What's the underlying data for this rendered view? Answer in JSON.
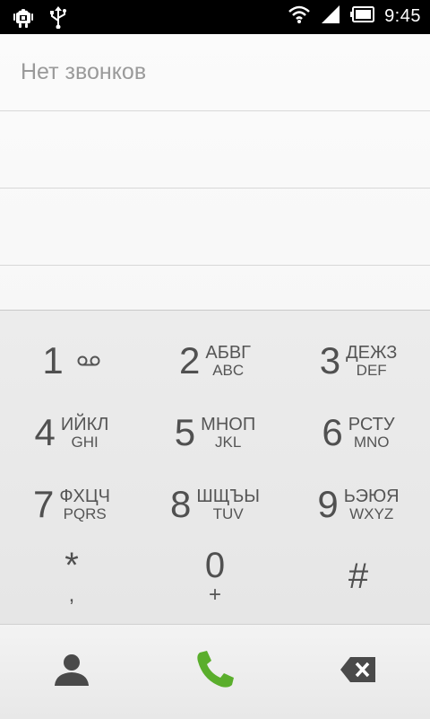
{
  "status_bar": {
    "left_icons": [
      "android-debug-icon",
      "usb-icon"
    ],
    "right_icons": [
      "wifi-icon",
      "signal-icon",
      "battery-icon"
    ],
    "time": "9:45"
  },
  "call_log": {
    "empty_text": "Нет звонков"
  },
  "keypad": {
    "keys": [
      {
        "digit": "1",
        "ru": "",
        "en": "",
        "icon": "voicemail-icon"
      },
      {
        "digit": "2",
        "ru": "АБВГ",
        "en": "ABC"
      },
      {
        "digit": "3",
        "ru": "ДЕЖЗ",
        "en": "DEF"
      },
      {
        "digit": "4",
        "ru": "ИЙКЛ",
        "en": "GHI"
      },
      {
        "digit": "5",
        "ru": "МНОП",
        "en": "JKL"
      },
      {
        "digit": "6",
        "ru": "РСТУ",
        "en": "MNO"
      },
      {
        "digit": "7",
        "ru": "ФХЦЧ",
        "en": "PQRS"
      },
      {
        "digit": "8",
        "ru": "ШЩЪЫ",
        "en": "TUV"
      },
      {
        "digit": "9",
        "ru": "ЬЭЮЯ",
        "en": "WXYZ"
      },
      {
        "digit": "*",
        "sub": ","
      },
      {
        "digit": "0",
        "sub": "+"
      },
      {
        "digit": "#",
        "sub": ""
      }
    ]
  },
  "action_bar": {
    "buttons": [
      "contacts-icon",
      "call-icon",
      "backspace-icon"
    ],
    "colors": {
      "call": "#5aae2c",
      "icon": "#4a4a4a"
    }
  }
}
